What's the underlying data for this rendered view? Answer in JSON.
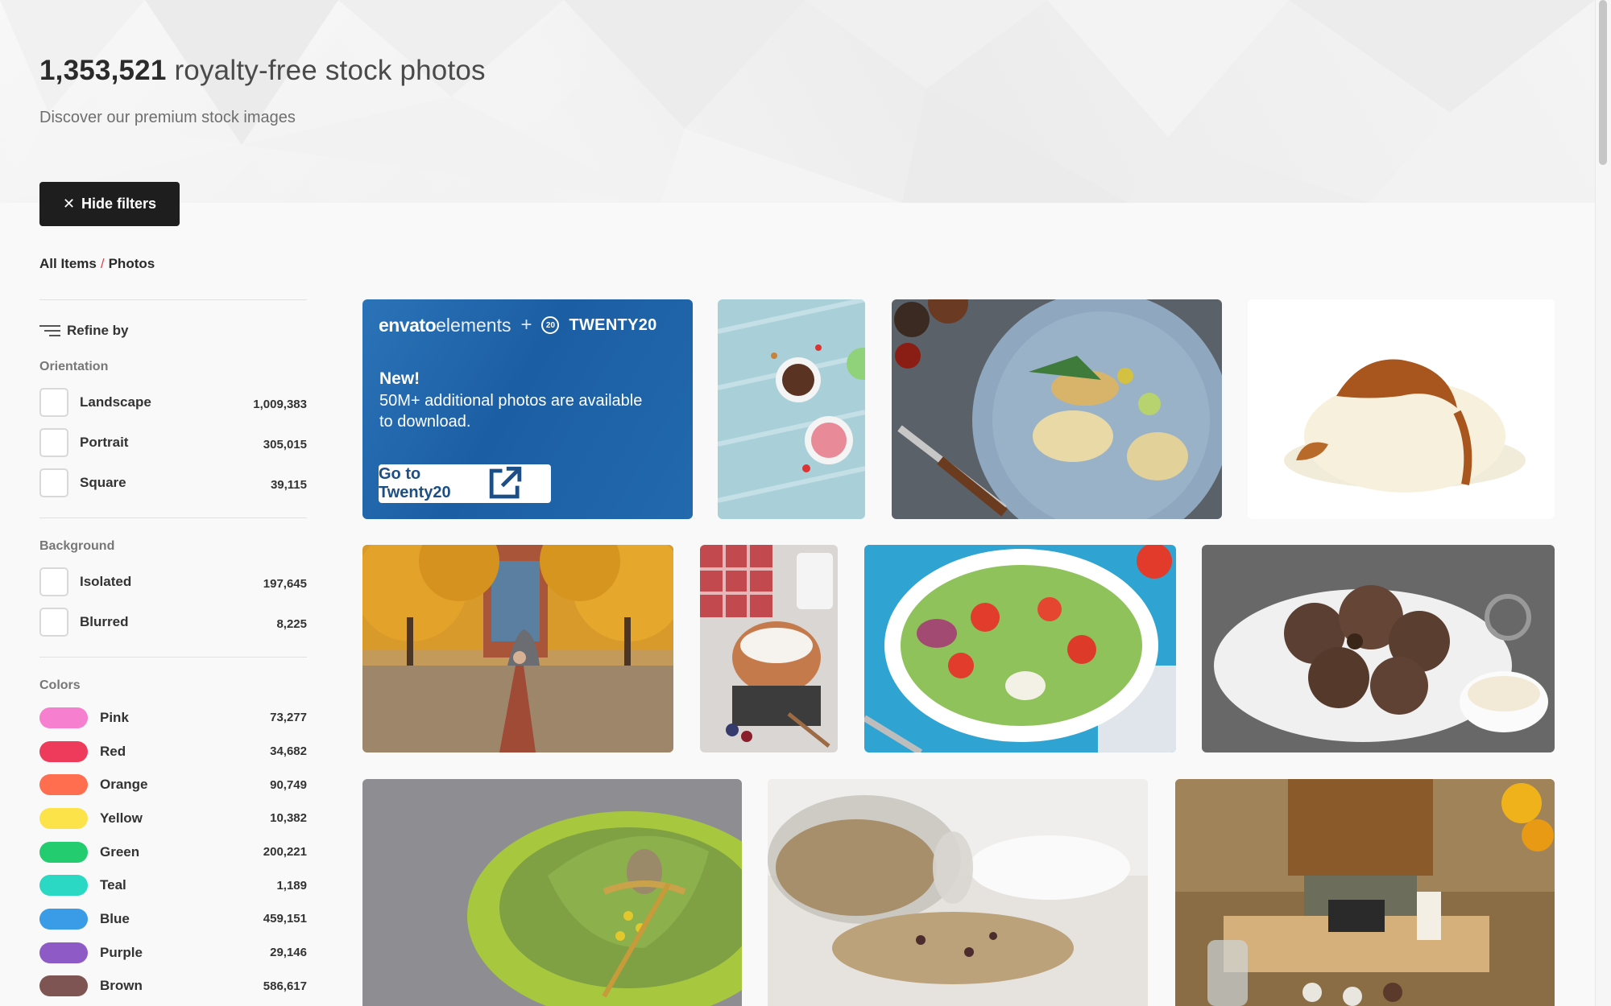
{
  "hero": {
    "count": "1,353,521",
    "title_rest": "royalty-free stock photos",
    "subtitle": "Discover our premium stock images"
  },
  "filters_button": {
    "label": "Hide filters",
    "icon": "close-icon"
  },
  "breadcrumb": {
    "root": "All Items",
    "separator": "/",
    "current": "Photos"
  },
  "refine": {
    "label": "Refine by",
    "icon": "filter-lines-icon"
  },
  "orientation": {
    "title": "Orientation",
    "options": [
      {
        "label": "Landscape",
        "count": "1,009,383"
      },
      {
        "label": "Portrait",
        "count": "305,015"
      },
      {
        "label": "Square",
        "count": "39,115"
      }
    ]
  },
  "background": {
    "title": "Background",
    "options": [
      {
        "label": "Isolated",
        "count": "197,645"
      },
      {
        "label": "Blurred",
        "count": "8,225"
      }
    ]
  },
  "colors": {
    "title": "Colors",
    "items": [
      {
        "label": "Pink",
        "count": "73,277",
        "hex": "#f77fd0"
      },
      {
        "label": "Red",
        "count": "34,682",
        "hex": "#ef3b5b"
      },
      {
        "label": "Orange",
        "count": "90,749",
        "hex": "#ff6e4f"
      },
      {
        "label": "Yellow",
        "count": "10,382",
        "hex": "#fde34a"
      },
      {
        "label": "Green",
        "count": "200,221",
        "hex": "#23cc6f"
      },
      {
        "label": "Teal",
        "count": "1,189",
        "hex": "#2ad8c3"
      },
      {
        "label": "Blue",
        "count": "459,151",
        "hex": "#3a9be6"
      },
      {
        "label": "Purple",
        "count": "29,146",
        "hex": "#8d5ac6"
      },
      {
        "label": "Brown",
        "count": "586,617",
        "hex": "#7e5552"
      }
    ]
  },
  "promo": {
    "logo_envato": "envato",
    "logo_elements": "elements",
    "logo_plus": "+",
    "logo_badge": "20",
    "logo_twenty": "TWENTY20",
    "headline": "New!",
    "description": "50M+ additional photos are available to download.",
    "cta_label": "Go to Twenty20",
    "cta_icon": "external-link-icon"
  },
  "photos": [
    {
      "name": "photo-smoothie-bowls"
    },
    {
      "name": "photo-grilled-squid"
    },
    {
      "name": "photo-ice-cream-caramel"
    },
    {
      "name": "photo-autumn-stretching"
    },
    {
      "name": "photo-copper-milk-pot"
    },
    {
      "name": "photo-green-salad"
    },
    {
      "name": "photo-chocolate-donuts"
    },
    {
      "name": "photo-easter-napkin"
    },
    {
      "name": "photo-granola-jar"
    },
    {
      "name": "photo-soap-making"
    }
  ],
  "accent_colors": {
    "promo_blue": "#1f64a9",
    "breadcrumb_sep": "#e2434b",
    "button_dark": "#1e1e1e"
  }
}
